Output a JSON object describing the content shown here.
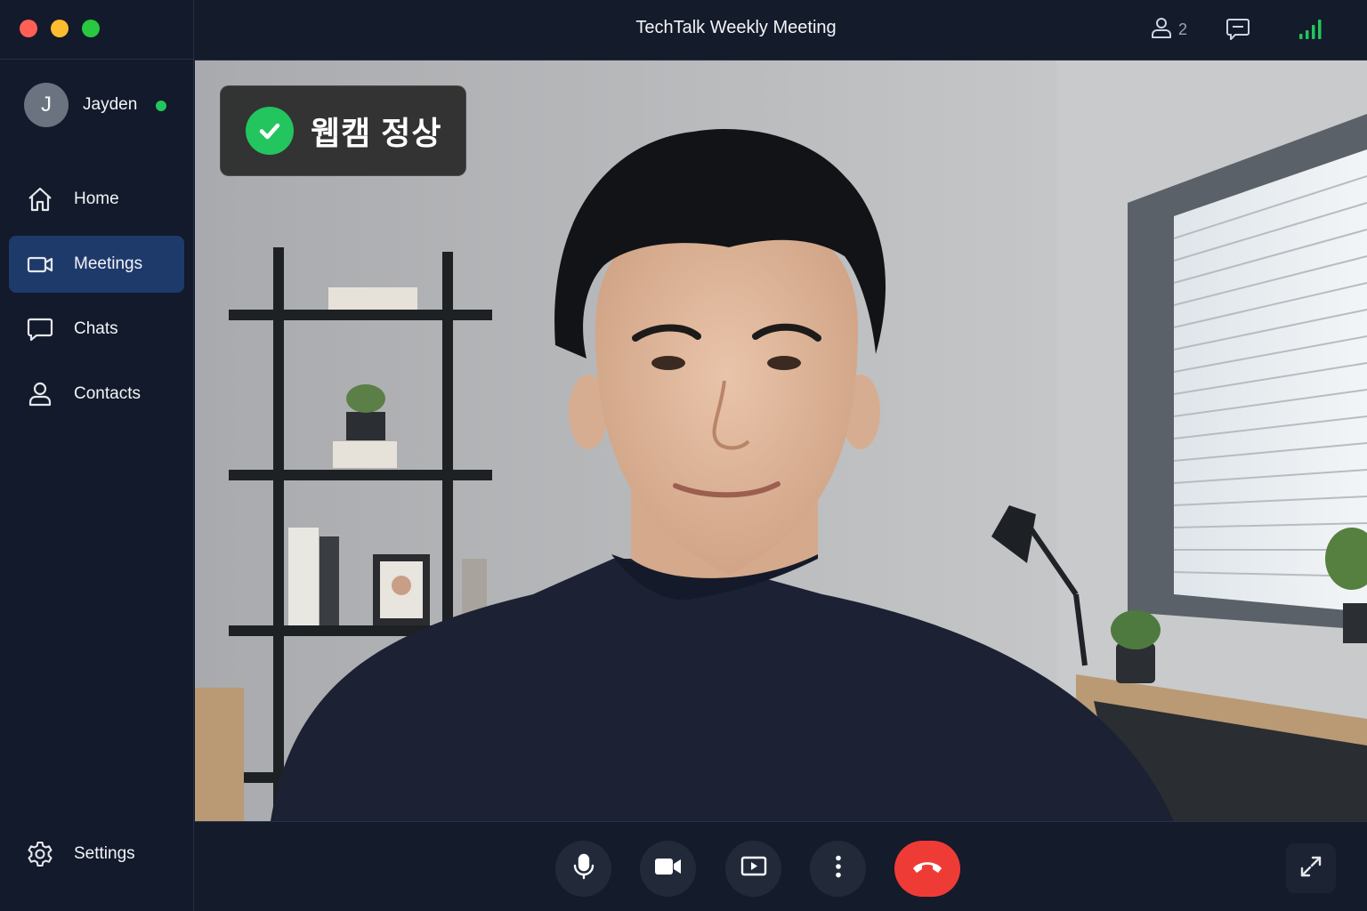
{
  "window": {
    "title": "TechTalk Weekly Meeting"
  },
  "user": {
    "initial": "J",
    "name": "Jayden",
    "status_color": "#22c55e"
  },
  "sidebar": {
    "items": [
      {
        "label": "Home",
        "icon": "home-icon",
        "active": false
      },
      {
        "label": "Meetings",
        "icon": "video-camera-icon",
        "active": true
      },
      {
        "label": "Chats",
        "icon": "chat-bubble-icon",
        "active": false
      },
      {
        "label": "Contacts",
        "icon": "person-icon",
        "active": false
      }
    ],
    "settings": {
      "label": "Settings",
      "icon": "gear-icon"
    }
  },
  "topbar": {
    "participants_count": "2",
    "participants_icon": "person-icon",
    "chat_icon": "chat-icon",
    "signal_icon": "signal-bars-icon",
    "signal_color": "#22c55e"
  },
  "video": {
    "status_badge": {
      "text": "웹캠 정상",
      "icon": "check-circle-icon",
      "color": "#22c55e"
    }
  },
  "controls": {
    "items": [
      "microphone-icon",
      "camera-icon",
      "screen-share-icon",
      "more-icon",
      "end-call-icon"
    ],
    "end_call_color": "#ef3b36",
    "expand_icon": "expand-icon"
  },
  "colors": {
    "accent": "#1e3a6b",
    "background": "#121a2b"
  }
}
